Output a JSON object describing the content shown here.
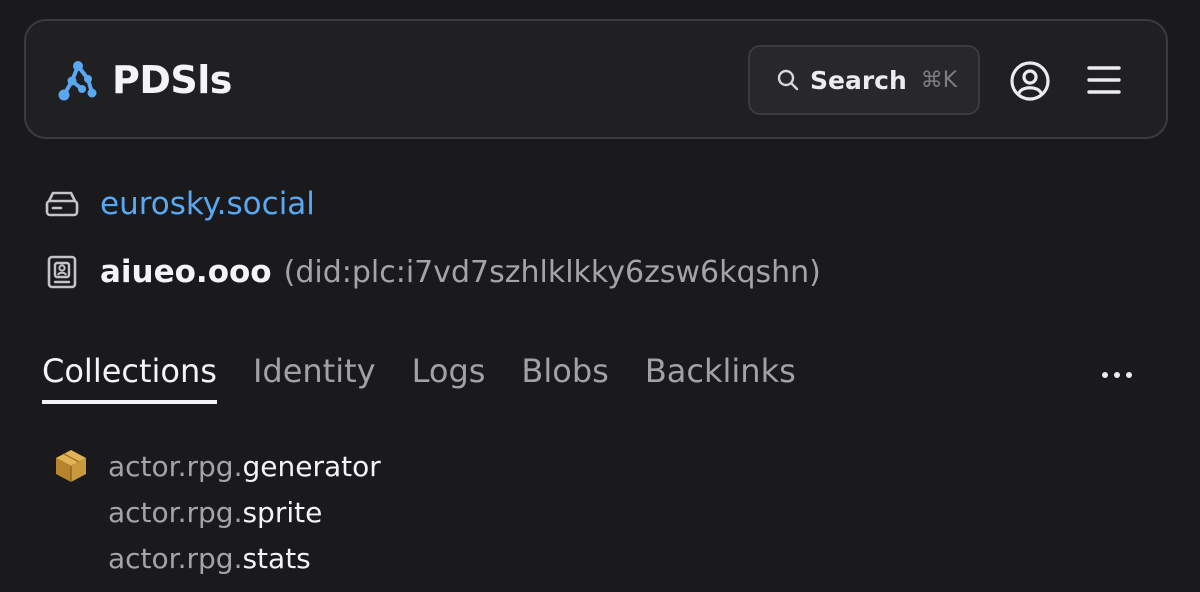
{
  "header": {
    "app_title": "PDSls",
    "search": {
      "label": "Search",
      "shortcut": "⌘K"
    },
    "account_icon": "user-circle-icon",
    "menu_icon": "hamburger-menu-icon"
  },
  "pds": {
    "icon": "server-drive-icon",
    "host": "eurosky.social"
  },
  "user": {
    "icon": "id-card-icon",
    "handle": "aiueo.ooo",
    "did": "(did:plc:i7vd7szhlklkky6zsw6kqshn)"
  },
  "tabs": [
    {
      "label": "Collections",
      "active": true
    },
    {
      "label": "Identity",
      "active": false
    },
    {
      "label": "Logs",
      "active": false
    },
    {
      "label": "Blobs",
      "active": false
    },
    {
      "label": "Backlinks",
      "active": false
    }
  ],
  "more_icon": "ellipsis-icon",
  "collections": [
    {
      "icon": "cube-icon",
      "items": [
        {
          "prefix": "actor.rpg.",
          "name": "generator"
        },
        {
          "prefix": "actor.rpg.",
          "name": "sprite"
        },
        {
          "prefix": "actor.rpg.",
          "name": "stats"
        }
      ]
    }
  ],
  "colors": {
    "background": "#1a1a1c",
    "link": "#5aa7f2",
    "logo": "#5aa7f2",
    "collection_icon": "#c99a3c"
  }
}
